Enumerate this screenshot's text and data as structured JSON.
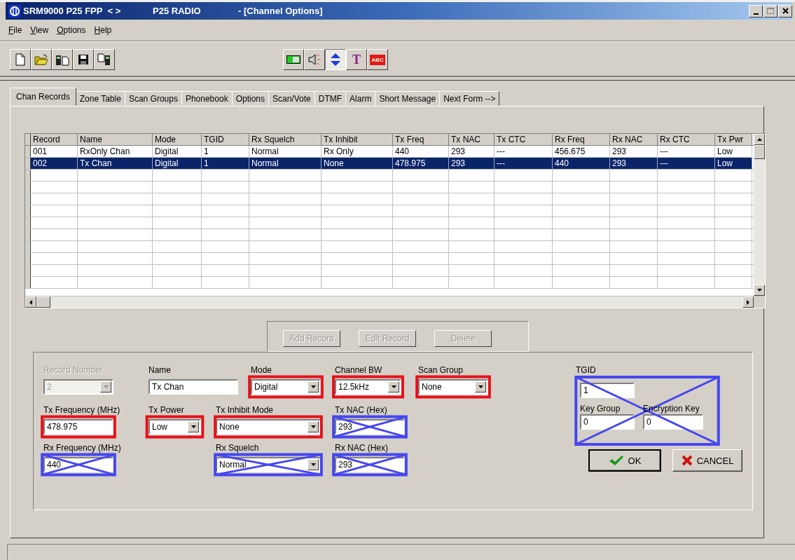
{
  "window": {
    "title": "SRM9000 P25 FPP  < >",
    "subtitle": "P25 RADIO",
    "document": "- [Channel Options]"
  },
  "menu": [
    "File",
    "View",
    "Options",
    "Help"
  ],
  "toolbar": {
    "left": [
      {
        "kind": "new"
      },
      {
        "kind": "open"
      },
      {
        "kind": "read"
      },
      {
        "kind": "save"
      },
      {
        "kind": "write"
      }
    ],
    "right": [
      {
        "kind": "device",
        "pressed": false
      },
      {
        "kind": "speaker",
        "pressed": false
      },
      {
        "kind": "updown",
        "pressed": true
      },
      {
        "kind": "glyph",
        "glyph": "T",
        "pressed": false
      },
      {
        "kind": "label",
        "glyph": "ABC",
        "pressed": false
      }
    ]
  },
  "tabs": [
    {
      "label": "Chan Records",
      "selected": true
    },
    {
      "label": "Zone Table",
      "selected": false
    },
    {
      "label": "Scan Groups",
      "selected": false
    },
    {
      "label": "Phonebook",
      "selected": false
    },
    {
      "label": "Options",
      "selected": false
    },
    {
      "label": "Scan/Vote",
      "selected": false
    },
    {
      "label": "DTMF",
      "selected": false
    },
    {
      "label": "Alarm",
      "selected": false
    },
    {
      "label": "Short Message",
      "selected": false
    },
    {
      "label": "Next Form -->",
      "selected": false
    }
  ],
  "table": {
    "columns": [
      "Record",
      "Name",
      "Mode",
      "TGID",
      "Rx Squelch",
      "Tx Inhibit",
      "Tx Freq",
      "Tx NAC",
      "Tx CTC",
      "Rx Freq",
      "Rx NAC",
      "Rx CTC",
      "Tx Pwr"
    ],
    "rows": [
      {
        "selected": false,
        "cells": [
          "001",
          "RxOnly Chan",
          "Digital",
          "1",
          "Normal",
          "Rx Only",
          "440",
          "293",
          "---",
          "456.675",
          "293",
          "---",
          "Low"
        ]
      },
      {
        "selected": true,
        "cells": [
          "002",
          "Tx Chan",
          "Digital",
          "1",
          "Normal",
          "None",
          "478.975",
          "293",
          "---",
          "440",
          "293",
          "---",
          "Low"
        ]
      }
    ]
  },
  "record_buttons": [
    {
      "label": "Add Record",
      "disabled": true
    },
    {
      "label": "Edit Record",
      "disabled": true
    },
    {
      "label": "Delete",
      "disabled": true
    }
  ],
  "fields": [
    {
      "label": "Record Number",
      "kind": "dropdown",
      "value": "2",
      "disabled": true
    },
    {
      "label": "Name",
      "kind": "text",
      "value": "Tx Chan",
      "disabled": false
    },
    {
      "label": "Mode",
      "kind": "dropdown",
      "value": "Digital",
      "disabled": false,
      "annotation": {
        "kind": "box",
        "color": "#e8101a"
      }
    },
    {
      "label": "Channel BW",
      "kind": "dropdown",
      "value": "12.5kHz",
      "disabled": false,
      "annotation": {
        "kind": "box",
        "color": "#e8101a"
      }
    },
    {
      "label": "Scan Group",
      "kind": "dropdown",
      "value": "None",
      "disabled": false,
      "annotation": {
        "kind": "box",
        "color": "#e8101a"
      }
    },
    {
      "label": "Tx Frequency (MHz)",
      "kind": "text",
      "value": "478.975",
      "disabled": false,
      "annotation": {
        "kind": "box",
        "color": "#e8101a"
      }
    },
    {
      "label": "Tx Power",
      "kind": "dropdown",
      "value": "Low",
      "disabled": false,
      "annotation": {
        "kind": "box",
        "color": "#e8101a"
      }
    },
    {
      "label": "Tx Inhibit Mode",
      "kind": "dropdown",
      "value": "None",
      "disabled": false,
      "annotation": {
        "kind": "box",
        "color": "#e8101a"
      }
    },
    {
      "label": "Tx NAC  (Hex)",
      "kind": "text",
      "value": "293",
      "disabled": false,
      "annotation": {
        "kind": "cross",
        "color": "#4646f0"
      }
    },
    {
      "label": "Rx Frequency (MHz)",
      "kind": "text",
      "value": "440",
      "disabled": false,
      "annotation": {
        "kind": "cross",
        "color": "#4646f0"
      }
    },
    {
      "label": "Rx Squelch",
      "kind": "dropdown",
      "value": "Normal",
      "disabled": false,
      "annotation": {
        "kind": "cross",
        "color": "#4646f0"
      }
    },
    {
      "label": "Rx NAC  (Hex)",
      "kind": "text",
      "value": "293",
      "disabled": false,
      "annotation": {
        "kind": "cross",
        "color": "#4646f0"
      }
    }
  ],
  "trunking": {
    "annotation": {
      "kind": "cross",
      "color": "#4646f0"
    },
    "fields": [
      {
        "label": "TGID",
        "value": "1"
      },
      {
        "label": "Key Group",
        "value": "0"
      },
      {
        "label": "Encryption Key",
        "value": "0"
      }
    ]
  },
  "dialog_buttons": [
    {
      "label": "OK",
      "kind": "ok"
    },
    {
      "label": "CANCEL",
      "kind": "cancel"
    }
  ]
}
